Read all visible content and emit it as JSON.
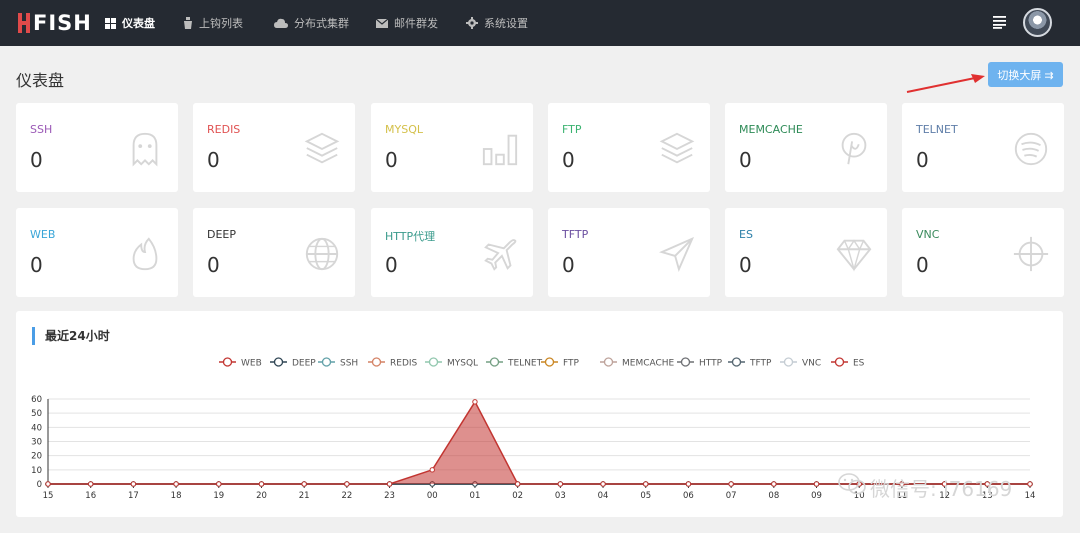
{
  "header": {
    "logo_text": "FISH",
    "nav": [
      {
        "label": "仪表盘",
        "icon": "dashboard-icon",
        "active": true
      },
      {
        "label": "上钩列表",
        "icon": "bucket-icon",
        "active": false
      },
      {
        "label": "分布式集群",
        "icon": "cloud-icon",
        "active": false
      },
      {
        "label": "邮件群发",
        "icon": "mail-icon",
        "active": false
      },
      {
        "label": "系统设置",
        "icon": "gear-icon",
        "active": false
      }
    ]
  },
  "page": {
    "title": "仪表盘",
    "big_screen_button": "切换大屏 ⇉"
  },
  "cards": [
    {
      "label": "SSH",
      "value": "0",
      "color": "#9b59b6",
      "icon": "ghost-icon"
    },
    {
      "label": "REDIS",
      "value": "0",
      "color": "#e05252",
      "icon": "layers-icon"
    },
    {
      "label": "MYSQL",
      "value": "0",
      "color": "#d4c04a",
      "icon": "bar-chart-icon"
    },
    {
      "label": "FTP",
      "value": "0",
      "color": "#3cb371",
      "icon": "layers-icon"
    },
    {
      "label": "MEMCACHE",
      "value": "0",
      "color": "#2e8b57",
      "icon": "pinterest-icon"
    },
    {
      "label": "TELNET",
      "value": "0",
      "color": "#5f7ea8",
      "icon": "spotify-icon"
    },
    {
      "label": "WEB",
      "value": "0",
      "color": "#3aa6d8",
      "icon": "fire-icon"
    },
    {
      "label": "DEEP",
      "value": "0",
      "color": "#333333",
      "icon": "globe-icon"
    },
    {
      "label": "HTTP代理",
      "value": "0",
      "color": "#3a9b8c",
      "icon": "plane-icon"
    },
    {
      "label": "TFTP",
      "value": "0",
      "color": "#6b4fa0",
      "icon": "send-icon"
    },
    {
      "label": "ES",
      "value": "0",
      "color": "#2c7fa8",
      "icon": "diamond-icon"
    },
    {
      "label": "VNC",
      "value": "0",
      "color": "#3a8a5c",
      "icon": "crosshair-icon"
    }
  ],
  "chart_title": "最近24小时",
  "chart_data": {
    "type": "area",
    "title": "最近24小时",
    "categories": [
      "15",
      "16",
      "17",
      "18",
      "19",
      "20",
      "21",
      "22",
      "23",
      "00",
      "01",
      "02",
      "03",
      "04",
      "05",
      "06",
      "07",
      "08",
      "09",
      "10",
      "11",
      "12",
      "13",
      "14"
    ],
    "ylim": [
      0,
      60
    ],
    "yticks": [
      0,
      10,
      20,
      30,
      40,
      50,
      60
    ],
    "grid": true,
    "legend_position": "top-center",
    "series": [
      {
        "name": "WEB",
        "color": "#c23531",
        "values": [
          0,
          0,
          0,
          0,
          0,
          0,
          0,
          0,
          0,
          10,
          58,
          0,
          0,
          0,
          0,
          0,
          0,
          0,
          0,
          0,
          0,
          0,
          0,
          0
        ]
      },
      {
        "name": "DEEP",
        "color": "#2f4554",
        "values": [
          0,
          0,
          0,
          0,
          0,
          0,
          0,
          0,
          0,
          0,
          0,
          0,
          0,
          0,
          0,
          0,
          0,
          0,
          0,
          0,
          0,
          0,
          0,
          0
        ]
      },
      {
        "name": "SSH",
        "color": "#61a0a8",
        "values": [
          0,
          0,
          0,
          0,
          0,
          0,
          0,
          0,
          0,
          0,
          0,
          0,
          0,
          0,
          0,
          0,
          0,
          0,
          0,
          0,
          0,
          0,
          0,
          0
        ]
      },
      {
        "name": "REDIS",
        "color": "#d48265",
        "values": [
          0,
          0,
          0,
          0,
          0,
          0,
          0,
          0,
          0,
          0,
          0,
          0,
          0,
          0,
          0,
          0,
          0,
          0,
          0,
          0,
          0,
          0,
          0,
          0
        ]
      },
      {
        "name": "MYSQL",
        "color": "#91c7ae",
        "values": [
          0,
          0,
          0,
          0,
          0,
          0,
          0,
          0,
          0,
          0,
          0,
          0,
          0,
          0,
          0,
          0,
          0,
          0,
          0,
          0,
          0,
          0,
          0,
          0
        ]
      },
      {
        "name": "TELNET",
        "color": "#749f83",
        "values": [
          0,
          0,
          0,
          0,
          0,
          0,
          0,
          0,
          0,
          0,
          0,
          0,
          0,
          0,
          0,
          0,
          0,
          0,
          0,
          0,
          0,
          0,
          0,
          0
        ]
      },
      {
        "name": "FTP",
        "color": "#ca8622",
        "values": [
          0,
          0,
          0,
          0,
          0,
          0,
          0,
          0,
          0,
          0,
          0,
          0,
          0,
          0,
          0,
          0,
          0,
          0,
          0,
          0,
          0,
          0,
          0,
          0
        ]
      },
      {
        "name": "MEMCACHE",
        "color": "#bda29a",
        "values": [
          0,
          0,
          0,
          0,
          0,
          0,
          0,
          0,
          0,
          0,
          0,
          0,
          0,
          0,
          0,
          0,
          0,
          0,
          0,
          0,
          0,
          0,
          0,
          0
        ]
      },
      {
        "name": "HTTP",
        "color": "#6e7074",
        "values": [
          0,
          0,
          0,
          0,
          0,
          0,
          0,
          0,
          0,
          0,
          0,
          0,
          0,
          0,
          0,
          0,
          0,
          0,
          0,
          0,
          0,
          0,
          0,
          0
        ]
      },
      {
        "name": "TFTP",
        "color": "#546570",
        "values": [
          0,
          0,
          0,
          0,
          0,
          0,
          0,
          0,
          0,
          0,
          0,
          0,
          0,
          0,
          0,
          0,
          0,
          0,
          0,
          0,
          0,
          0,
          0,
          0
        ]
      },
      {
        "name": "VNC",
        "color": "#c4ccd3",
        "values": [
          0,
          0,
          0,
          0,
          0,
          0,
          0,
          0,
          0,
          0,
          0,
          0,
          0,
          0,
          0,
          0,
          0,
          0,
          0,
          0,
          0,
          0,
          0,
          0
        ]
      },
      {
        "name": "ES",
        "color": "#c23531",
        "values": [
          0,
          0,
          0,
          0,
          0,
          0,
          0,
          0,
          0,
          0,
          0,
          0,
          0,
          0,
          0,
          0,
          0,
          0,
          0,
          0,
          0,
          0,
          0,
          0
        ]
      }
    ]
  },
  "watermark": "微信号: i76169"
}
